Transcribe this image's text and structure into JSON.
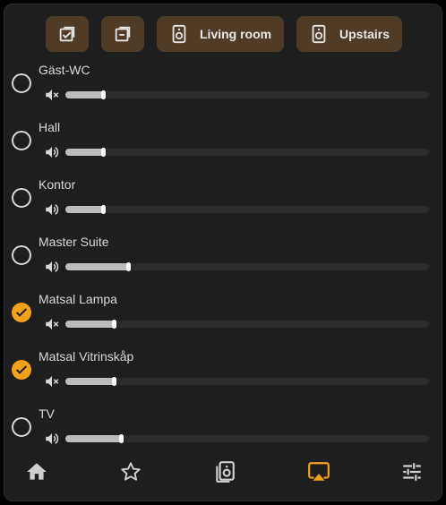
{
  "toolbar": {
    "select_all_label": "",
    "select_none_label": "",
    "groups": [
      {
        "label": "Living room"
      },
      {
        "label": "Upstairs"
      }
    ]
  },
  "rooms": [
    {
      "name": "Gäst-WC",
      "checked": false,
      "muted": true,
      "volume": 0.11
    },
    {
      "name": "Hall",
      "checked": false,
      "muted": false,
      "volume": 0.11
    },
    {
      "name": "Kontor",
      "checked": false,
      "muted": false,
      "volume": 0.11
    },
    {
      "name": "Master Suite",
      "checked": false,
      "muted": false,
      "volume": 0.18
    },
    {
      "name": "Matsal Lampa",
      "checked": true,
      "muted": true,
      "volume": 0.14
    },
    {
      "name": "Matsal Vitrinskåp",
      "checked": true,
      "muted": true,
      "volume": 0.14
    },
    {
      "name": "TV",
      "checked": false,
      "muted": false,
      "volume": 0.16
    }
  ],
  "nav": {
    "items": [
      "home-icon",
      "star-icon",
      "speaker-icon",
      "airplay-icon",
      "sliders-icon"
    ],
    "active": "airplay-icon"
  },
  "colors": {
    "accent": "#f4a019",
    "chip_bg": "#4f3b26",
    "card_bg": "#1e1e1e",
    "text": "#d8d8d8",
    "track": "#2b2b2b",
    "fill": "#bdbdbd"
  }
}
